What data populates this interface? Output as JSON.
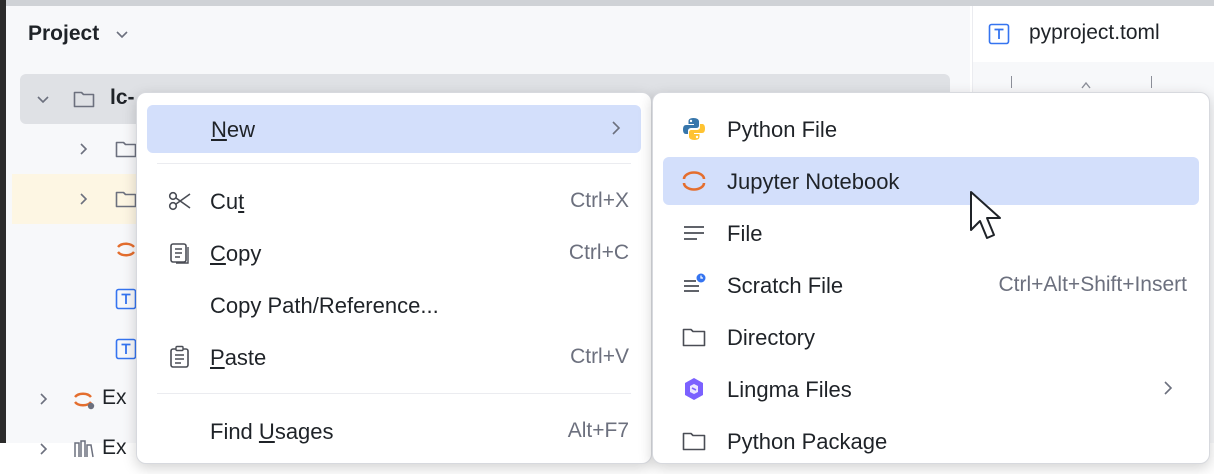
{
  "project_panel": {
    "title": "Project",
    "tree": [
      {
        "label": "lc-",
        "icon": "folder-icon",
        "bold": true,
        "expanded": true
      },
      {
        "label": "",
        "icon": "folder-icon"
      },
      {
        "label": "",
        "icon": "folder-icon"
      },
      {
        "label": "",
        "icon": "jupyter-icon"
      },
      {
        "label": "",
        "icon": "text-file-icon"
      },
      {
        "label": "",
        "icon": "text-file-icon"
      },
      {
        "label": "Ex",
        "icon": "jupyter-icon"
      },
      {
        "label": "Ex",
        "icon": "library-icon"
      }
    ]
  },
  "editor": {
    "tab_label": "pyproject.toml"
  },
  "context_menu": {
    "items": [
      {
        "label": "New",
        "shortcut": "",
        "has_submenu": true,
        "active": true
      },
      {
        "label": "Cut",
        "shortcut": "Ctrl+X"
      },
      {
        "label": "Copy",
        "shortcut": "Ctrl+C"
      },
      {
        "label": "Copy Path/Reference...",
        "shortcut": ""
      },
      {
        "label": "Paste",
        "shortcut": "Ctrl+V"
      },
      {
        "label": "Find Usages",
        "shortcut": "Alt+F7"
      }
    ]
  },
  "new_submenu": {
    "items": [
      {
        "label": "Python File",
        "shortcut": ""
      },
      {
        "label": "Jupyter Notebook",
        "shortcut": "",
        "active": true
      },
      {
        "label": "File",
        "shortcut": ""
      },
      {
        "label": "Scratch File",
        "shortcut": "Ctrl+Alt+Shift+Insert"
      },
      {
        "label": "Directory",
        "shortcut": ""
      },
      {
        "label": "Lingma Files",
        "shortcut": "",
        "has_submenu": true
      },
      {
        "label": "Python Package",
        "shortcut": ""
      }
    ]
  },
  "colors": {
    "accent_active": "#d3dffb",
    "jupyter_orange": "#e46e2e",
    "text_icon_blue": "#3574f0"
  }
}
